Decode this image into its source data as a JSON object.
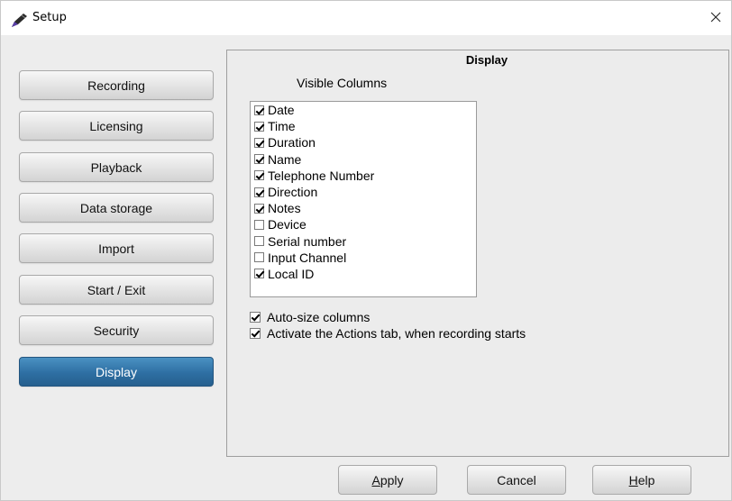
{
  "window": {
    "title": "Setup",
    "close_glyph": "×",
    "icon": "setup-app-icon"
  },
  "nav": {
    "items": [
      {
        "label": "Recording",
        "active": false
      },
      {
        "label": "Licensing",
        "active": false
      },
      {
        "label": "Playback",
        "active": false
      },
      {
        "label": "Data storage",
        "active": false
      },
      {
        "label": "Import",
        "active": false
      },
      {
        "label": "Start / Exit",
        "active": false
      },
      {
        "label": "Security",
        "active": false
      },
      {
        "label": "Display",
        "active": true
      }
    ]
  },
  "panel": {
    "title": "Display",
    "visible_columns_label": "Visible Columns",
    "columns": [
      {
        "label": "Date",
        "checked": true
      },
      {
        "label": "Time",
        "checked": true
      },
      {
        "label": "Duration",
        "checked": true
      },
      {
        "label": "Name",
        "checked": true
      },
      {
        "label": "Telephone Number",
        "checked": true
      },
      {
        "label": "Direction",
        "checked": true
      },
      {
        "label": "Notes",
        "checked": true
      },
      {
        "label": "Device",
        "checked": false
      },
      {
        "label": "Serial number",
        "checked": false
      },
      {
        "label": "Input Channel",
        "checked": false
      },
      {
        "label": "Local ID",
        "checked": true
      }
    ],
    "options": [
      {
        "label": "Auto-size columns",
        "checked": true
      },
      {
        "label": "Activate the Actions tab, when recording starts",
        "checked": true
      }
    ]
  },
  "buttons": {
    "apply": {
      "mnemonic": "A",
      "rest": "pply"
    },
    "cancel": {
      "label": "Cancel"
    },
    "help": {
      "mnemonic": "H",
      "rest": "elp"
    }
  },
  "colors": {
    "active_nav": "#2e6fa3",
    "window_bg": "#ededed"
  }
}
